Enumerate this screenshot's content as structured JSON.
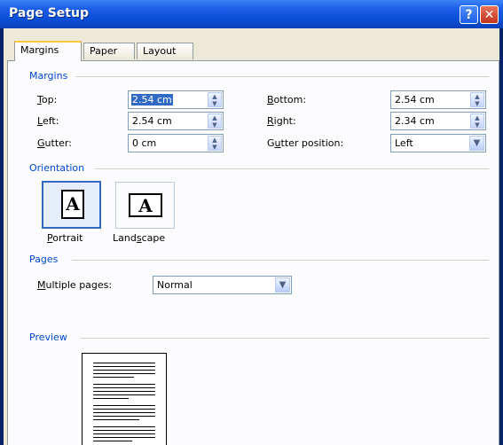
{
  "window": {
    "title": "Page Setup",
    "help_glyph": "?",
    "close_glyph": "✕"
  },
  "tabs": [
    {
      "label": "Margins",
      "active": true
    },
    {
      "label": "Paper",
      "active": false
    },
    {
      "label": "Layout",
      "active": false
    }
  ],
  "margins": {
    "group_label": "Margins",
    "top": {
      "label_pre": "",
      "label_key": "T",
      "label_post": "op:",
      "value": "2.54 cm"
    },
    "left": {
      "label_pre": "",
      "label_key": "L",
      "label_post": "eft:",
      "value": "2.54 cm"
    },
    "gutter": {
      "label_pre": "",
      "label_key": "G",
      "label_post": "utter:",
      "value": "0 cm"
    },
    "bottom": {
      "label_pre": "",
      "label_key": "B",
      "label_post": "ottom:",
      "value": "2.54 cm"
    },
    "right": {
      "label_pre": "",
      "label_key": "R",
      "label_post": "ight:",
      "value": "2.34 cm"
    },
    "gutter_position": {
      "label_pre": "G",
      "label_key": "u",
      "label_post": "tter position:",
      "value": "Left"
    }
  },
  "orientation": {
    "group_label": "Orientation",
    "portrait": {
      "label_pre": "",
      "label_key": "P",
      "label_post": "ortrait",
      "glyph": "A",
      "selected": true
    },
    "landscape": {
      "label_pre": "Land",
      "label_key": "s",
      "label_post": "cape",
      "glyph": "A",
      "selected": false
    }
  },
  "pages": {
    "group_label": "Pages",
    "multiple_pages": {
      "label_pre": "",
      "label_key": "M",
      "label_post": "ultiple pages:",
      "value": "Normal"
    }
  },
  "preview": {
    "group_label": "Preview"
  },
  "icons": {
    "spin": "spin-arrows-icon",
    "dropdown": "chevron-down-icon"
  },
  "colors": {
    "title_bar": "#0a4ed6",
    "group_label": "#0046d5",
    "selection": "#316ac5",
    "dialog_bg": "#fcfcfe"
  }
}
